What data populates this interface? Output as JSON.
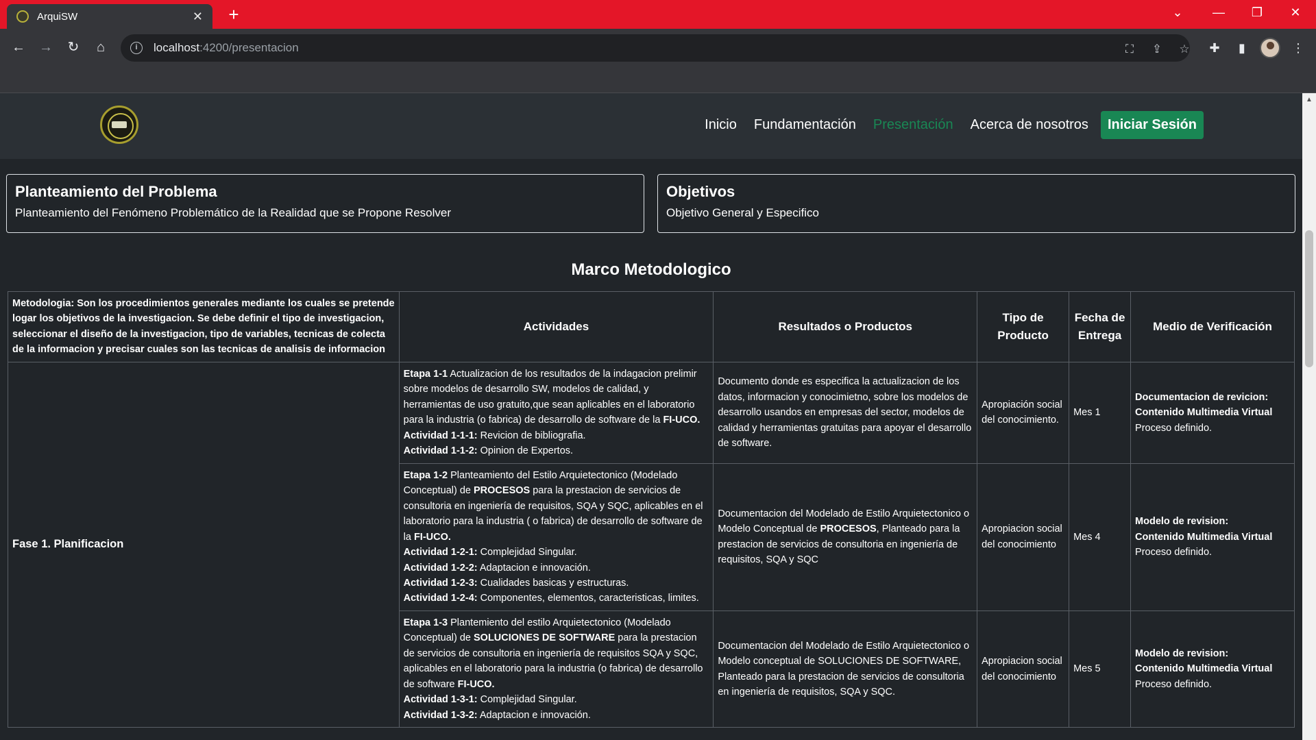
{
  "browser": {
    "tab_title": "ArquiSW",
    "tab_close": "✕",
    "new_tab": "+",
    "url_host": "localhost",
    "url_path": ":4200/presentacion"
  },
  "navbar": {
    "links": [
      "Inicio",
      "Fundamentación",
      "Presentación",
      "Acerca de nosotros"
    ],
    "active": "Presentación",
    "login_label": "Iniciar Sesión"
  },
  "cards": [
    {
      "title": "Planteamiento del Problema",
      "subtitle": "Planteamiento del Fenómeno Problemático de la Realidad que se Propone Resolver"
    },
    {
      "title": "Objetivos",
      "subtitle": "Objetivo General y Especifico"
    }
  ],
  "section_title": "Marco Metodologico",
  "table": {
    "metodologia_label": "Metodologia:",
    "metodologia_text": " Son los procedimientos generales mediante los cuales se pretende logar los objetivos de la investigacion. Se debe definir el tipo de investigacion, seleccionar el diseño de la investigacion, tipo de variables, tecnicas de colecta de la informacion y precisar cuales son las tecnicas de analisis de informacion",
    "headers": [
      "Actividades",
      "Resultados o Productos",
      "Tipo de Producto",
      "Fecha de Entrega",
      "Medio de Verificación"
    ],
    "phase": "Fase 1. Planificacion",
    "rows": [
      {
        "etapa_label": "Etapa 1-1",
        "etapa_text": " Actualizacion de los resultados de la indagacion prelimir sobre modelos de desarrollo SW, modelos de calidad, y herramientas de uso gratuito,que sean aplicables en el laboratorio para la industria (o fabrica) de desarrollo de software de la ",
        "etapa_bold_end": "FI-UCO.",
        "activities": [
          {
            "label": "Actividad 1-1-1:",
            "text": " Revicion de bibliografia."
          },
          {
            "label": "Actividad 1-1-2:",
            "text": " Opinion de Expertos."
          }
        ],
        "resultado_parts": [
          "Documento donde es especifica la actualizacion de los datos, informacion y conocimietno, sobre los modelos de desarrollo usandos en empresas del sector, modelos de calidad y herramientas gratuitas para apoyar el desarrollo de software.",
          "",
          ""
        ],
        "tipo": "Apropiación social del conocimiento.",
        "fecha": "Mes 1",
        "medio_1": "Documentacion de revicion:",
        "medio_2": "Contenido Multimedia Virtual",
        "medio_3": "Proceso definido."
      },
      {
        "etapa_label": "Etapa 1-2",
        "etapa_text_a": " Planteamiento del Estilo Arquietectonico (Modelado Conceptual) de ",
        "etapa_bold_mid": "PROCESOS",
        "etapa_text_b": " para la prestacion de servicios de consultoria en ingeniería de requisitos, SQA y SQC, aplicables en el laboratorio para la industria ( o fabrica) de desarrollo de software de la ",
        "etapa_bold_end": "FI-UCO.",
        "activities": [
          {
            "label": "Actividad 1-2-1:",
            "text": " Complejidad Singular."
          },
          {
            "label": "Actividad 1-2-2:",
            "text": " Adaptacion e innovación."
          },
          {
            "label": "Actividad 1-2-3:",
            "text": " Cualidades basicas y estructuras."
          },
          {
            "label": "Actividad 1-2-4:",
            "text": " Componentes, elementos, caracteristicas, limites."
          }
        ],
        "resultado_a": "Documentacion del Modelado de Estilo Arquietectonico o Modelo Conceptual de ",
        "resultado_bold": "PROCESOS",
        "resultado_b": ", Planteado para la prestacion de servicios de consultoria en ingeniería de requisitos, SQA y SQC",
        "tipo": "Apropiacion social del conocimiento",
        "fecha": "Mes 4",
        "medio_1": "Modelo de revision:",
        "medio_2": "Contenido Multimedia Virtual",
        "medio_3": "Proceso definido."
      },
      {
        "etapa_label": "Etapa 1-3",
        "etapa_text_a": " Plantemiento del estilo Arquietectonico (Modelado Conceptual) de ",
        "etapa_bold_mid": "SOLUCIONES DE SOFTWARE",
        "etapa_text_b": " para la prestacion de servicios de consultoria en ingeniería de requisitos SQA y SQC, aplicables en el laboratorio para la industria (o fabrica) de desarrollo de software ",
        "etapa_bold_end": "FI-UCO.",
        "activities": [
          {
            "label": "Actividad 1-3-1:",
            "text": " Complejidad Singular."
          },
          {
            "label": "Actividad 1-3-2:",
            "text": " Adaptacion e innovación."
          }
        ],
        "resultado": "Documentacion del Modelado de Estilo Arquietectonico o Modelo conceptual de SOLUCIONES DE SOFTWARE, Planteado para la prestacion de servicios de consultoria en ingeniería de requisitos, SQA y SQC.",
        "tipo": "Apropiacion social del conocimiento",
        "fecha": "Mes 5",
        "medio_1": "Modelo de revision:",
        "medio_2": "Contenido Multimedia Virtual",
        "medio_3": "Proceso definido."
      }
    ]
  }
}
